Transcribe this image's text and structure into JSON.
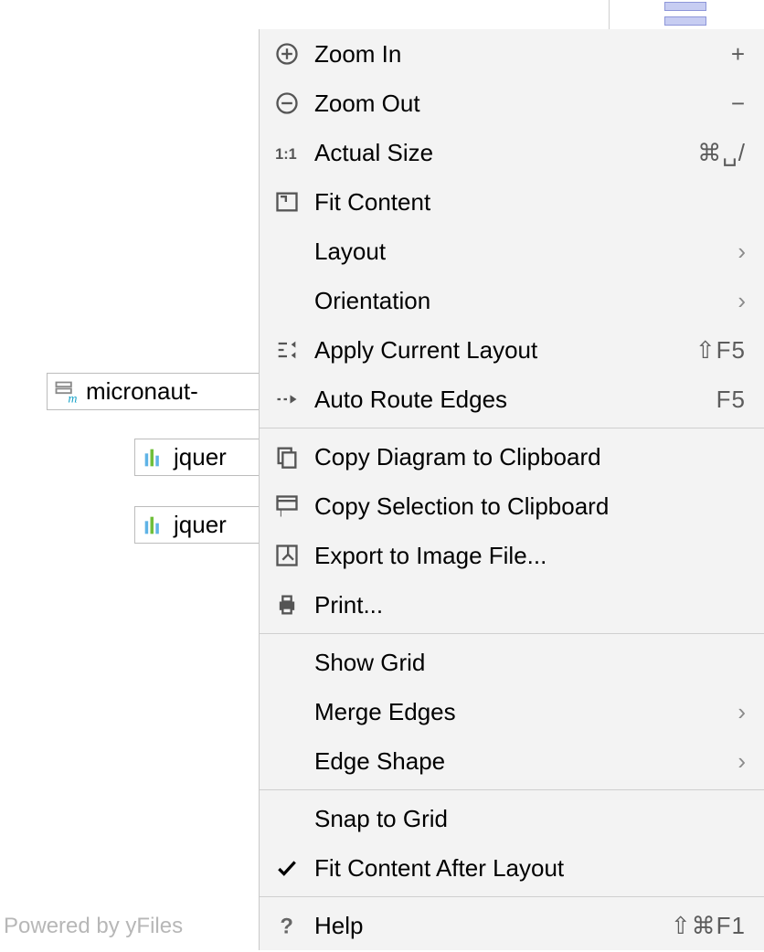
{
  "diagram": {
    "nodes": [
      {
        "label": "micronaut-",
        "type": "module"
      },
      {
        "label": "jquer",
        "type": "library"
      },
      {
        "label": "jquer",
        "type": "library"
      }
    ],
    "watermark": "Powered by yFiles"
  },
  "menu": {
    "groups": [
      [
        {
          "id": "zoom-in",
          "label": "Zoom In",
          "icon": "plus-circle",
          "shortcut": "+"
        },
        {
          "id": "zoom-out",
          "label": "Zoom Out",
          "icon": "minus-circle",
          "shortcut": "−"
        },
        {
          "id": "actual-size",
          "label": "Actual Size",
          "icon": "one-to-one",
          "shortcut": "⌘␣/"
        },
        {
          "id": "fit-content",
          "label": "Fit Content",
          "icon": "fit-rect"
        },
        {
          "id": "layout",
          "label": "Layout",
          "submenu": true
        },
        {
          "id": "orientation",
          "label": "Orientation",
          "submenu": true
        },
        {
          "id": "apply-layout",
          "label": "Apply Current Layout",
          "icon": "apply-layout",
          "shortcut": "⇧F5"
        },
        {
          "id": "auto-route",
          "label": "Auto Route Edges",
          "icon": "route",
          "shortcut": "F5"
        }
      ],
      [
        {
          "id": "copy-diagram",
          "label": "Copy Diagram to Clipboard",
          "icon": "copy"
        },
        {
          "id": "copy-selection",
          "label": "Copy Selection to Clipboard",
          "icon": "copy-selection"
        },
        {
          "id": "export-image",
          "label": "Export to Image File...",
          "icon": "export"
        },
        {
          "id": "print",
          "label": "Print...",
          "icon": "print"
        }
      ],
      [
        {
          "id": "show-grid",
          "label": "Show Grid"
        },
        {
          "id": "merge-edges",
          "label": "Merge Edges",
          "submenu": true
        },
        {
          "id": "edge-shape",
          "label": "Edge Shape",
          "submenu": true
        }
      ],
      [
        {
          "id": "snap-grid",
          "label": "Snap to Grid"
        },
        {
          "id": "fit-after",
          "label": "Fit Content After Layout",
          "checked": true
        }
      ],
      [
        {
          "id": "help",
          "label": "Help",
          "icon": "question",
          "shortcut": "⇧⌘F1"
        }
      ]
    ]
  }
}
